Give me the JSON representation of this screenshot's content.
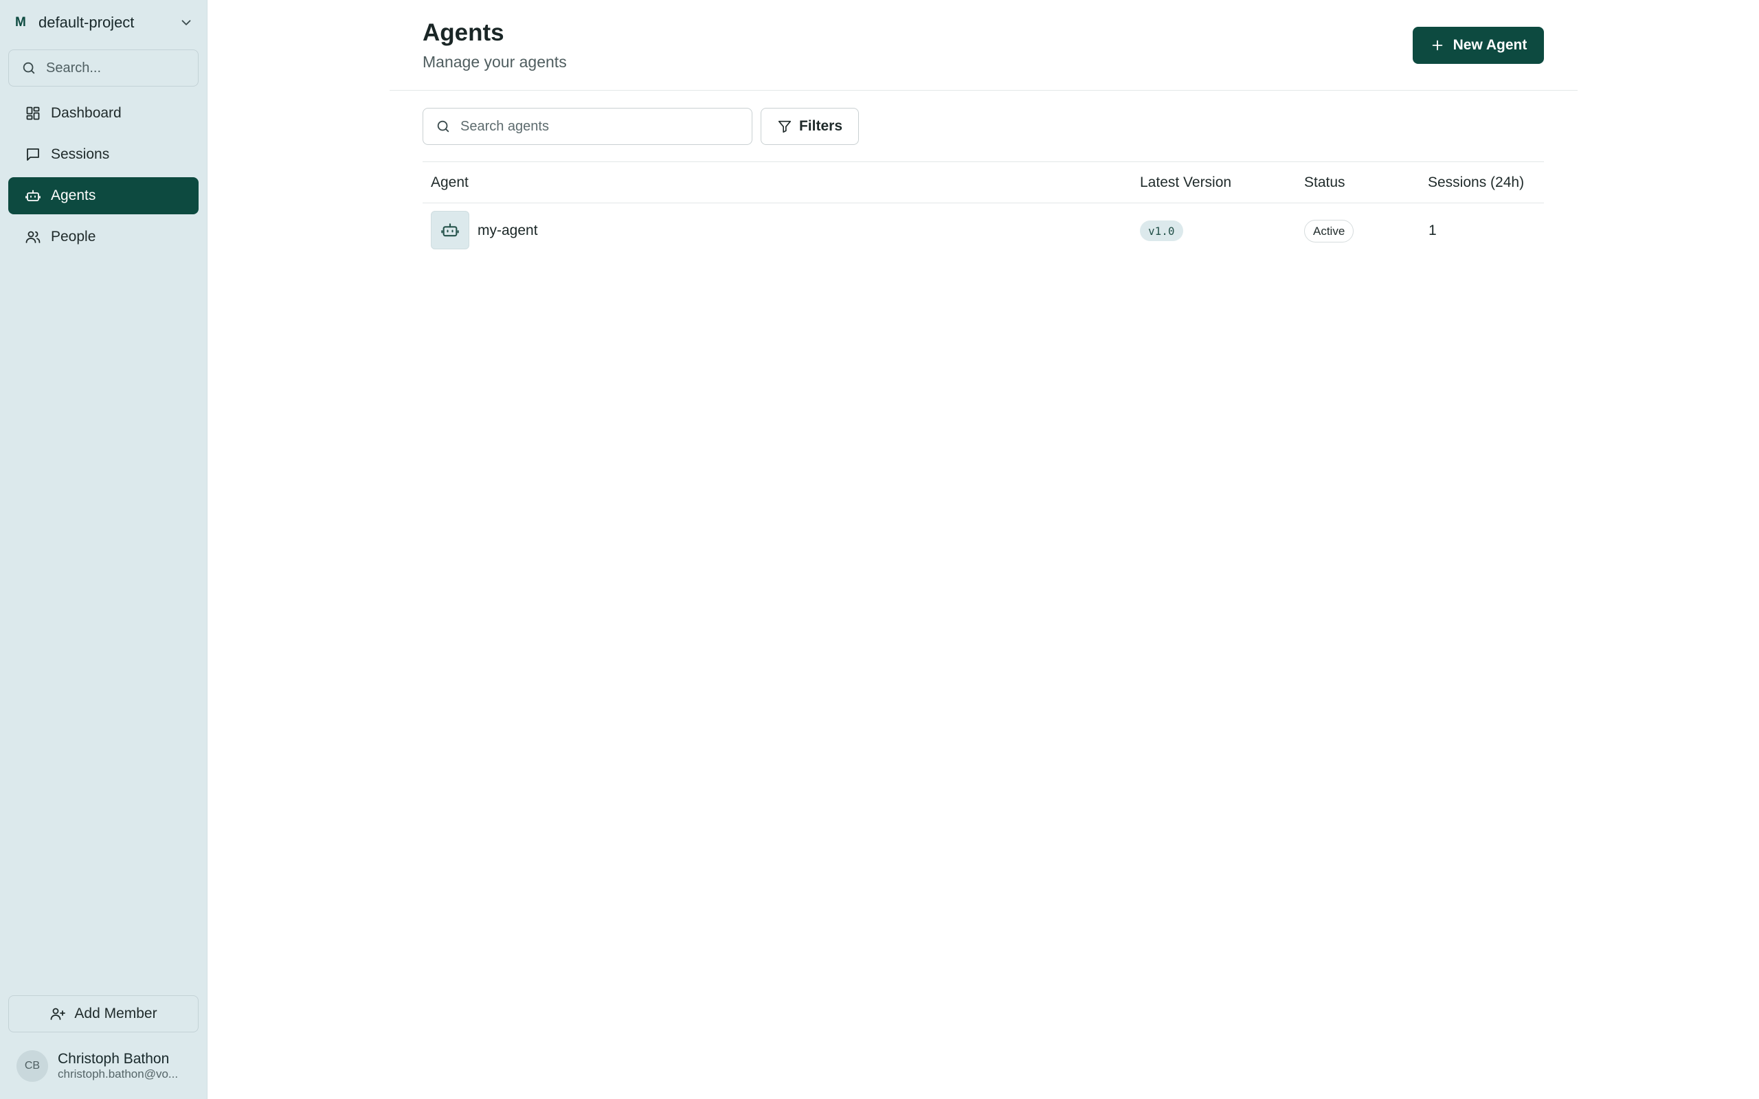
{
  "sidebar": {
    "project": {
      "initial": "M",
      "name": "default-project"
    },
    "search": {
      "placeholder": "Search..."
    },
    "nav": [
      {
        "label": "Dashboard",
        "icon": "dashboard-icon",
        "active": false
      },
      {
        "label": "Sessions",
        "icon": "chat-icon",
        "active": false
      },
      {
        "label": "Agents",
        "icon": "robot-icon",
        "active": true
      },
      {
        "label": "People",
        "icon": "users-icon",
        "active": false
      }
    ],
    "add_member_label": "Add Member",
    "user": {
      "initials": "CB",
      "name": "Christoph Bathon",
      "email": "christoph.bathon@vo..."
    }
  },
  "main": {
    "title": "Agents",
    "subtitle": "Manage your agents",
    "new_agent_label": "New Agent",
    "search_placeholder": "Search agents",
    "filters_label": "Filters",
    "table": {
      "columns": [
        "Agent",
        "Latest Version",
        "Status",
        "Sessions (24h)"
      ],
      "rows": [
        {
          "agent": "my-agent",
          "version": "v1.0",
          "status": "Active",
          "sessions": "1"
        }
      ]
    }
  },
  "colors": {
    "accent": "#0d4a40",
    "sidebar_bg": "#dce9ec"
  }
}
